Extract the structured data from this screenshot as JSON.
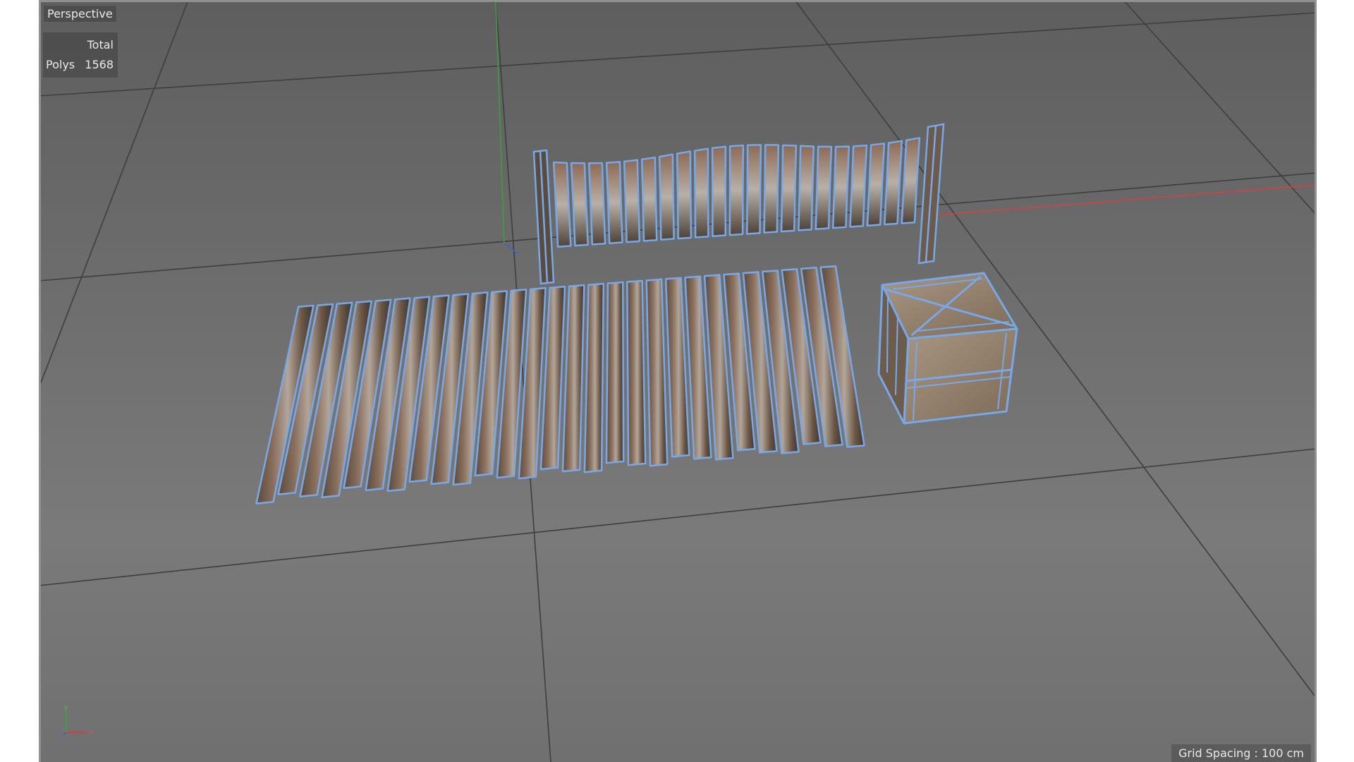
{
  "viewport": {
    "view_name": "Perspective",
    "stats_header": "Total",
    "stats_label": "Polys",
    "stats_value": "1568",
    "grid_spacing_text": "Grid Spacing : 100 cm"
  },
  "colors": {
    "wire": "#78a8e8",
    "axis_x": "#d84040",
    "axis_y": "#3ca040",
    "axis_z": "#4060d8"
  },
  "icons": [
    "axis-gizmo-icon"
  ]
}
